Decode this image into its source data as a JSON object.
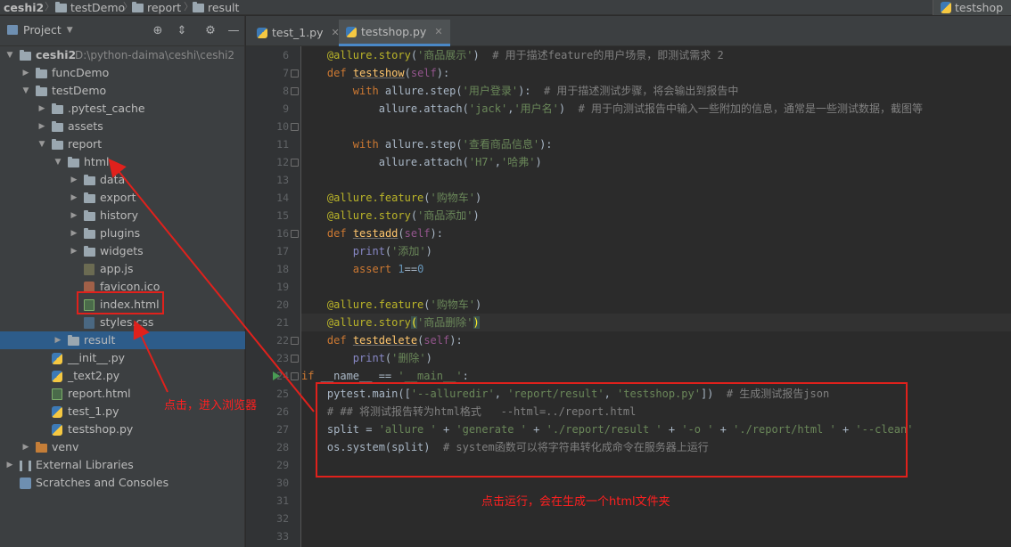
{
  "navbar": {
    "crumbs": [
      "ceshi2",
      "testDemo",
      "report",
      "result"
    ],
    "run_config": "testshop"
  },
  "project_panel": {
    "title": "Project",
    "tree": [
      {
        "label": "ceshi2",
        "path": "D:\\python-daima\\ceshi\\ceshi2",
        "kind": "root",
        "depth": 0,
        "expanded": true
      },
      {
        "label": "funcDemo",
        "kind": "folder",
        "depth": 1,
        "expanded": false
      },
      {
        "label": "testDemo",
        "kind": "folder",
        "depth": 1,
        "expanded": true
      },
      {
        "label": ".pytest_cache",
        "kind": "folder",
        "depth": 2,
        "expanded": false
      },
      {
        "label": "assets",
        "kind": "folder",
        "depth": 2,
        "expanded": false
      },
      {
        "label": "report",
        "kind": "folder",
        "depth": 2,
        "expanded": true
      },
      {
        "label": "html",
        "kind": "folder",
        "depth": 3,
        "expanded": true
      },
      {
        "label": "data",
        "kind": "folder",
        "depth": 4,
        "expanded": false
      },
      {
        "label": "export",
        "kind": "folder",
        "depth": 4,
        "expanded": false
      },
      {
        "label": "history",
        "kind": "folder",
        "depth": 4,
        "expanded": false
      },
      {
        "label": "plugins",
        "kind": "folder",
        "depth": 4,
        "expanded": false
      },
      {
        "label": "widgets",
        "kind": "folder",
        "depth": 4,
        "expanded": false
      },
      {
        "label": "app.js",
        "kind": "js",
        "depth": 4
      },
      {
        "label": "favicon.ico",
        "kind": "ico",
        "depth": 4
      },
      {
        "label": "index.html",
        "kind": "html",
        "depth": 4
      },
      {
        "label": "styles.css",
        "kind": "css",
        "depth": 4
      },
      {
        "label": "result",
        "kind": "folder",
        "depth": 3,
        "expanded": false,
        "selected": true
      },
      {
        "label": "__init__.py",
        "kind": "py",
        "depth": 2
      },
      {
        "label": "_text2.py",
        "kind": "py",
        "depth": 2
      },
      {
        "label": "report.html",
        "kind": "html",
        "depth": 2
      },
      {
        "label": "test_1.py",
        "kind": "py",
        "depth": 2
      },
      {
        "label": "testshop.py",
        "kind": "py",
        "depth": 2
      },
      {
        "label": "venv",
        "kind": "folder-orange",
        "depth": 1,
        "expanded": false
      },
      {
        "label": "External Libraries",
        "kind": "lib",
        "depth": 0,
        "expanded": false
      },
      {
        "label": "Scratches and Consoles",
        "kind": "scratch",
        "depth": 0
      }
    ]
  },
  "tabs": [
    {
      "label": "test_1.py",
      "active": false
    },
    {
      "label": "testshop.py",
      "active": true
    }
  ],
  "editor": {
    "line_numbers": [
      "6",
      "7",
      "8",
      "9",
      "10",
      "11",
      "12",
      "13",
      "14",
      "15",
      "16",
      "17",
      "18",
      "19",
      "20",
      "21",
      "22",
      "23",
      "24",
      "25",
      "26",
      "27",
      "28",
      "29",
      "30",
      "31",
      "32",
      "33"
    ]
  },
  "annotations": {
    "left_note": "点击，进入浏览器",
    "bottom_note": "点击运行，会在生成一个html文件夹"
  },
  "colors": {
    "accent_red": "#e0211c",
    "selection": "#2d5c8a",
    "editor_bg": "#2b2b2b",
    "panel_bg": "#3c3f41"
  }
}
